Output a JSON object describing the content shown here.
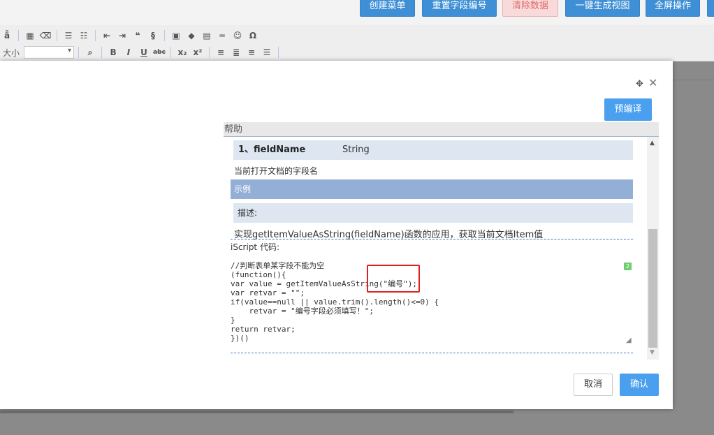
{
  "topbar": {
    "buttons": [
      "创建菜单",
      "重置字段编号",
      "清除数据",
      "一键生成视图",
      "全屏操作"
    ]
  },
  "toolbar": {
    "size_label": "大小",
    "row1_icons": [
      "spell-icon",
      "table-icon",
      "eraser-icon",
      "ordered-list-icon",
      "unordered-list-icon",
      "outdent-icon",
      "indent-icon",
      "blockquote-icon",
      "code-icon",
      "image-icon",
      "attachment-icon",
      "grid-icon",
      "horizontal-rule-icon",
      "emoticon-icon",
      "special-char-icon"
    ],
    "row2_glyphs": [
      "B",
      "I",
      "U",
      "abc",
      "x₂",
      "x²"
    ]
  },
  "modal": {
    "precompile_label": "预编译",
    "help_title": "帮助",
    "param_name": "1、fieldName",
    "param_type": "String",
    "param_desc": "当前打开文档的字段名",
    "example_label": "示例",
    "desc_label": "描述:",
    "desc_text": "实现getItemValueAsString(fieldName)函数的应用，获取当前文档Item值",
    "code_title": "iScript 代码:",
    "code": "//判断表单某字段不能为空\n(function(){\nvar value = getItemValueAsString(\"编号\");\nvar retvar = \"\";\nif(value==null || value.trim().length()<=0) {\n    retvar = \"编号字段必须填写！\";\n}\nreturn retvar;\n})()",
    "code_badge": "2",
    "cancel_label": "取消",
    "ok_label": "确认"
  },
  "colors": {
    "primary": "#4aa0ee",
    "example_bar": "#93afd6",
    "highlight": "#e02020"
  }
}
